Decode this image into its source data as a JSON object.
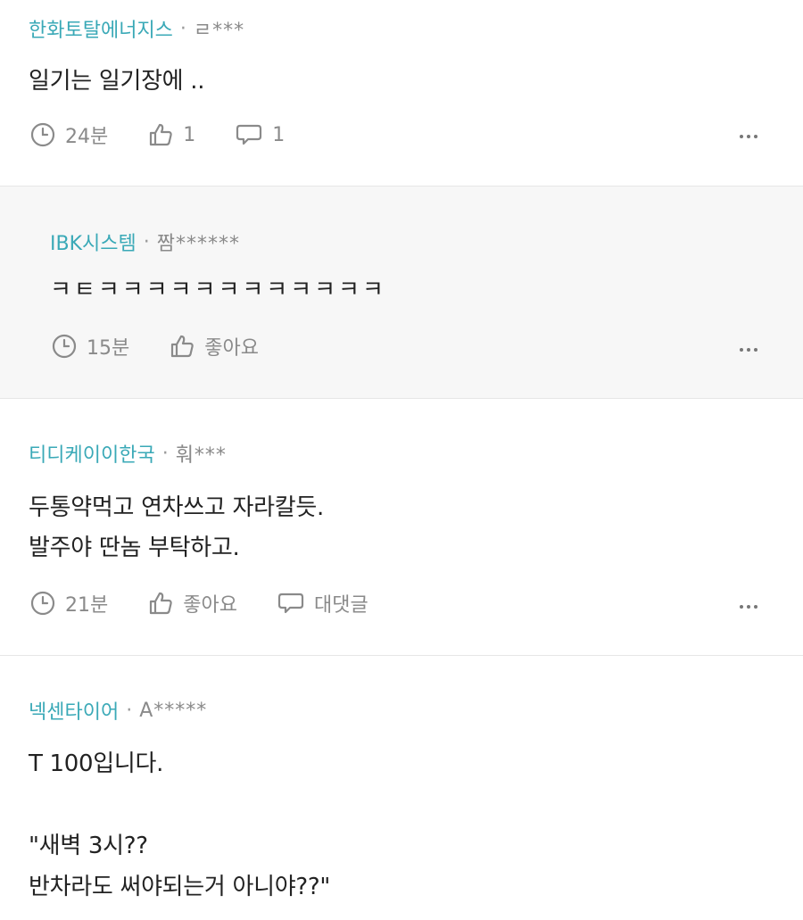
{
  "colors": {
    "company": "#3aa9b7",
    "muted": "#8a8a8a",
    "reply_bg": "#f7f7f7"
  },
  "comments": [
    {
      "company": "한화토탈에너지스",
      "user": "ㄹ***",
      "lines": [
        "일기는 일기장에 .."
      ],
      "time": "24분",
      "like": "1",
      "reply": "1",
      "icons": [
        "clock-icon",
        "thumbs-up-icon",
        "speech-bubble-icon",
        "more-icon"
      ]
    },
    {
      "company": "IBK시스템",
      "user": "짬******",
      "lines": [
        "ㅋㅌㅋㅋㅋㅋㅋㅋㅋㅋㅋㅋㅋㅋ"
      ],
      "time": "15분",
      "like": "좋아요",
      "icons": [
        "clock-icon",
        "thumbs-up-icon",
        "more-icon"
      ]
    },
    {
      "company": "티디케이이한국",
      "user": "훠***",
      "lines": [
        "두통약먹고 연차쓰고 자라칼듯.",
        "발주야 딴놈 부탁하고."
      ],
      "time": "21분",
      "like": "좋아요",
      "reply": "대댓글",
      "icons": [
        "clock-icon",
        "thumbs-up-icon",
        "speech-bubble-icon",
        "more-icon"
      ]
    },
    {
      "company": "넥센타이어",
      "user": "A*****",
      "lines": [
        "T 100입니다.",
        "\"새벽 3시??",
        "반차라도 써야되는거 아니야??\""
      ]
    }
  ]
}
